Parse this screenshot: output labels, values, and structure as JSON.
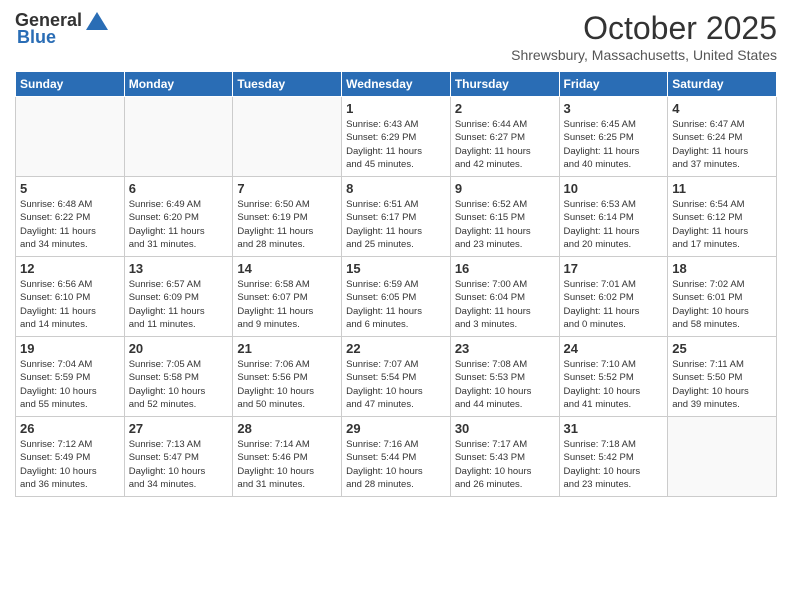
{
  "header": {
    "logo_general": "General",
    "logo_blue": "Blue",
    "month_title": "October 2025",
    "location": "Shrewsbury, Massachusetts, United States"
  },
  "days_of_week": [
    "Sunday",
    "Monday",
    "Tuesday",
    "Wednesday",
    "Thursday",
    "Friday",
    "Saturday"
  ],
  "weeks": [
    [
      {
        "num": "",
        "info": ""
      },
      {
        "num": "",
        "info": ""
      },
      {
        "num": "",
        "info": ""
      },
      {
        "num": "1",
        "info": "Sunrise: 6:43 AM\nSunset: 6:29 PM\nDaylight: 11 hours\nand 45 minutes."
      },
      {
        "num": "2",
        "info": "Sunrise: 6:44 AM\nSunset: 6:27 PM\nDaylight: 11 hours\nand 42 minutes."
      },
      {
        "num": "3",
        "info": "Sunrise: 6:45 AM\nSunset: 6:25 PM\nDaylight: 11 hours\nand 40 minutes."
      },
      {
        "num": "4",
        "info": "Sunrise: 6:47 AM\nSunset: 6:24 PM\nDaylight: 11 hours\nand 37 minutes."
      }
    ],
    [
      {
        "num": "5",
        "info": "Sunrise: 6:48 AM\nSunset: 6:22 PM\nDaylight: 11 hours\nand 34 minutes."
      },
      {
        "num": "6",
        "info": "Sunrise: 6:49 AM\nSunset: 6:20 PM\nDaylight: 11 hours\nand 31 minutes."
      },
      {
        "num": "7",
        "info": "Sunrise: 6:50 AM\nSunset: 6:19 PM\nDaylight: 11 hours\nand 28 minutes."
      },
      {
        "num": "8",
        "info": "Sunrise: 6:51 AM\nSunset: 6:17 PM\nDaylight: 11 hours\nand 25 minutes."
      },
      {
        "num": "9",
        "info": "Sunrise: 6:52 AM\nSunset: 6:15 PM\nDaylight: 11 hours\nand 23 minutes."
      },
      {
        "num": "10",
        "info": "Sunrise: 6:53 AM\nSunset: 6:14 PM\nDaylight: 11 hours\nand 20 minutes."
      },
      {
        "num": "11",
        "info": "Sunrise: 6:54 AM\nSunset: 6:12 PM\nDaylight: 11 hours\nand 17 minutes."
      }
    ],
    [
      {
        "num": "12",
        "info": "Sunrise: 6:56 AM\nSunset: 6:10 PM\nDaylight: 11 hours\nand 14 minutes."
      },
      {
        "num": "13",
        "info": "Sunrise: 6:57 AM\nSunset: 6:09 PM\nDaylight: 11 hours\nand 11 minutes."
      },
      {
        "num": "14",
        "info": "Sunrise: 6:58 AM\nSunset: 6:07 PM\nDaylight: 11 hours\nand 9 minutes."
      },
      {
        "num": "15",
        "info": "Sunrise: 6:59 AM\nSunset: 6:05 PM\nDaylight: 11 hours\nand 6 minutes."
      },
      {
        "num": "16",
        "info": "Sunrise: 7:00 AM\nSunset: 6:04 PM\nDaylight: 11 hours\nand 3 minutes."
      },
      {
        "num": "17",
        "info": "Sunrise: 7:01 AM\nSunset: 6:02 PM\nDaylight: 11 hours\nand 0 minutes."
      },
      {
        "num": "18",
        "info": "Sunrise: 7:02 AM\nSunset: 6:01 PM\nDaylight: 10 hours\nand 58 minutes."
      }
    ],
    [
      {
        "num": "19",
        "info": "Sunrise: 7:04 AM\nSunset: 5:59 PM\nDaylight: 10 hours\nand 55 minutes."
      },
      {
        "num": "20",
        "info": "Sunrise: 7:05 AM\nSunset: 5:58 PM\nDaylight: 10 hours\nand 52 minutes."
      },
      {
        "num": "21",
        "info": "Sunrise: 7:06 AM\nSunset: 5:56 PM\nDaylight: 10 hours\nand 50 minutes."
      },
      {
        "num": "22",
        "info": "Sunrise: 7:07 AM\nSunset: 5:54 PM\nDaylight: 10 hours\nand 47 minutes."
      },
      {
        "num": "23",
        "info": "Sunrise: 7:08 AM\nSunset: 5:53 PM\nDaylight: 10 hours\nand 44 minutes."
      },
      {
        "num": "24",
        "info": "Sunrise: 7:10 AM\nSunset: 5:52 PM\nDaylight: 10 hours\nand 41 minutes."
      },
      {
        "num": "25",
        "info": "Sunrise: 7:11 AM\nSunset: 5:50 PM\nDaylight: 10 hours\nand 39 minutes."
      }
    ],
    [
      {
        "num": "26",
        "info": "Sunrise: 7:12 AM\nSunset: 5:49 PM\nDaylight: 10 hours\nand 36 minutes."
      },
      {
        "num": "27",
        "info": "Sunrise: 7:13 AM\nSunset: 5:47 PM\nDaylight: 10 hours\nand 34 minutes."
      },
      {
        "num": "28",
        "info": "Sunrise: 7:14 AM\nSunset: 5:46 PM\nDaylight: 10 hours\nand 31 minutes."
      },
      {
        "num": "29",
        "info": "Sunrise: 7:16 AM\nSunset: 5:44 PM\nDaylight: 10 hours\nand 28 minutes."
      },
      {
        "num": "30",
        "info": "Sunrise: 7:17 AM\nSunset: 5:43 PM\nDaylight: 10 hours\nand 26 minutes."
      },
      {
        "num": "31",
        "info": "Sunrise: 7:18 AM\nSunset: 5:42 PM\nDaylight: 10 hours\nand 23 minutes."
      },
      {
        "num": "",
        "info": ""
      }
    ]
  ]
}
